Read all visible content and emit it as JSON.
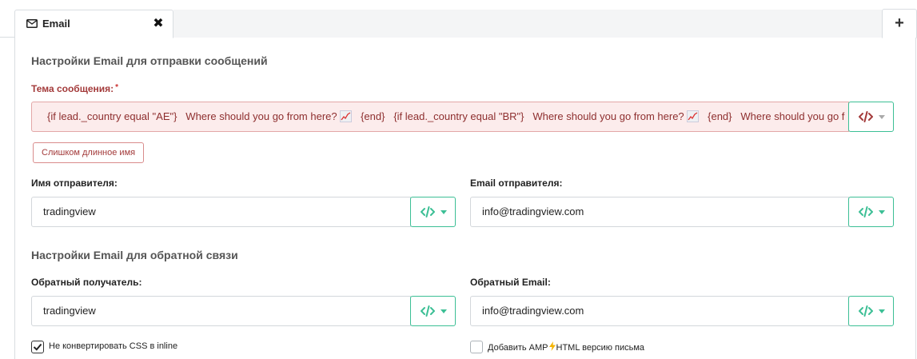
{
  "tab": {
    "label": "Email",
    "close_glyph": "✖"
  },
  "add_tab_glyph": "+",
  "section_send": {
    "title": "Настройки Email для отправки сообщений",
    "subject_label": "Тема сообщения:",
    "subject_required": "*",
    "subject_parts": [
      "{if lead._country equal \"AE\"}",
      "Where should you go from here?",
      "{end}",
      "{if lead._country equal \"BR\"}",
      "Where should you go from here?",
      "{end}",
      "Where should you go f"
    ],
    "subject_error": "Слишком длинное имя",
    "sender_name_label": "Имя отправителя:",
    "sender_name_value": "tradingview",
    "sender_email_label": "Email отправителя:",
    "sender_email_value": "info@tradingview.com"
  },
  "section_reply": {
    "title": "Настройки Email для обратной связи",
    "reply_recipient_label": "Обратный получатель:",
    "reply_recipient_value": "tradingview",
    "reply_email_label": "Обратный Email:",
    "reply_email_value": "info@tradingview.com"
  },
  "checkboxes": {
    "no_inline_css": {
      "label": "Не конвертировать CSS в inline",
      "checked": true
    },
    "amp_version": {
      "label_before": "Добавить AMP",
      "label_after": "HTML версию письма",
      "checked": false,
      "icon": "lightning-icon"
    }
  },
  "colors": {
    "accent": "#3cbf95",
    "error_text": "#a33a3a",
    "error_bg": "#fcecec"
  },
  "icons": {
    "code": "code-icon",
    "envelope": "envelope-icon",
    "chart": "chart-increasing-icon"
  }
}
